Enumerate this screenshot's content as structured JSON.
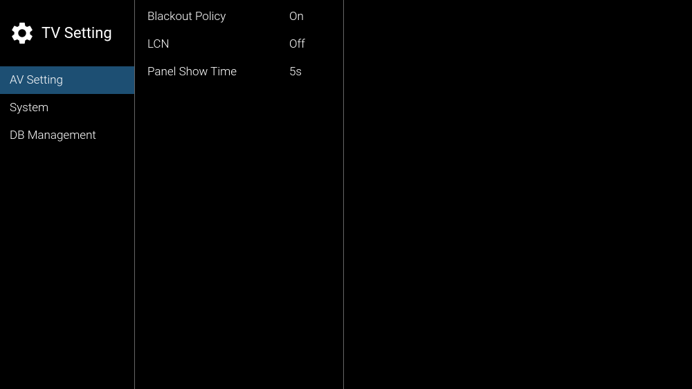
{
  "header": {
    "title": "TV Setting"
  },
  "sidebar": {
    "items": [
      {
        "label": "AV Setting",
        "selected": true
      },
      {
        "label": "System",
        "selected": false
      },
      {
        "label": "DB Management",
        "selected": false
      }
    ]
  },
  "content": {
    "options": [
      {
        "label": "Blackout Policy",
        "value": "On"
      },
      {
        "label": "LCN",
        "value": "Off"
      },
      {
        "label": "Panel Show Time",
        "value": "5s"
      }
    ]
  }
}
